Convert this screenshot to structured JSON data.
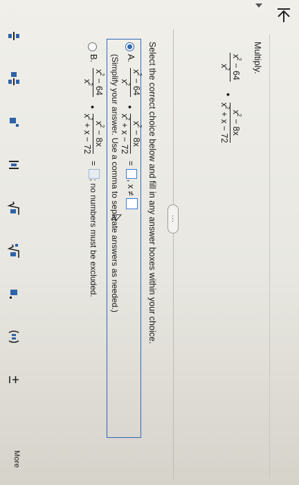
{
  "prompt": "Multiply.",
  "problem": {
    "frac1_num_base": "x",
    "frac1_num_exp": "2",
    "frac1_num_rest": " − 64",
    "frac1_den_base": "x",
    "frac1_den_exp": "2",
    "dot": "•",
    "frac2_num_base": "x",
    "frac2_num_exp": "2",
    "frac2_num_rest": " − 8x",
    "frac2_den_base": "x",
    "frac2_den_exp": "2",
    "frac2_den_rest": " + x − 72"
  },
  "more_button": "...",
  "instruction": "Select the correct choice below and fill in any answer boxes within your choice.",
  "choice_a": {
    "letter": "A.",
    "equals": "=",
    "restriction": ", x ≠",
    "note": "(Simplify your answer. Use a comma to separate answers as needed.)"
  },
  "choice_b": {
    "letter": "B.",
    "equals": "=",
    "note": "; no numbers must be excluded."
  },
  "toolbar": {
    "more_label": "More"
  },
  "colors": {
    "accent": "#2f67b5",
    "answer_box": "#3a7bd5"
  }
}
